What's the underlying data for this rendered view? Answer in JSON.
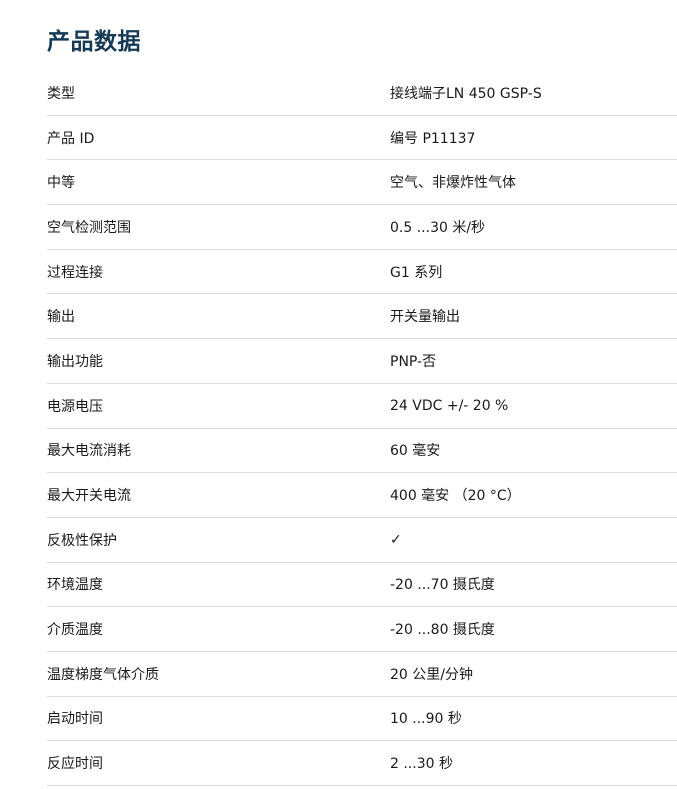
{
  "section": {
    "title": "产品数据"
  },
  "specs": [
    {
      "label": "类型",
      "value": "接线端子LN 450 GSP-S"
    },
    {
      "label": "产品 ID",
      "value": "编号 P11137"
    },
    {
      "label": "中等",
      "value": "空气、非爆炸性气体"
    },
    {
      "label": "空气检测范围",
      "value": "0.5 ...30 米/秒"
    },
    {
      "label": "过程连接",
      "value": "G1 系列"
    },
    {
      "label": "输出",
      "value": "开关量输出"
    },
    {
      "label": "输出功能",
      "value": "PNP-否"
    },
    {
      "label": "电源电压",
      "value": "24 VDC +/- 20 %"
    },
    {
      "label": "最大电流消耗",
      "value": "60 毫安"
    },
    {
      "label": "最大开关电流",
      "value": "400 毫安 （20 °C）"
    },
    {
      "label": "反极性保护",
      "value": "✓"
    },
    {
      "label": "环境温度",
      "value": "-20 ...70 摄氏度"
    },
    {
      "label": "介质温度",
      "value": "-20 ...80 摄氏度"
    },
    {
      "label": "温度梯度气体介质",
      "value": "20 公里/分钟"
    },
    {
      "label": "启动时间",
      "value": "10 ...90 秒"
    },
    {
      "label": "反应时间",
      "value": "2 ...30 秒"
    }
  ]
}
